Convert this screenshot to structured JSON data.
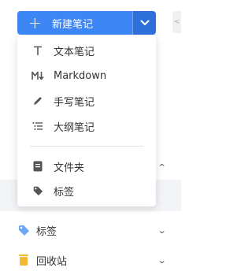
{
  "new_note": {
    "label": "新建笔记",
    "plus_icon": "plus-icon",
    "dropdown_icon": "chevron-down-icon",
    "accent": "#3d86f5"
  },
  "menu": {
    "items": [
      {
        "label": "文本笔记",
        "icon": "text-T-icon"
      },
      {
        "label": "Markdown",
        "icon": "markdown-icon"
      },
      {
        "label": "手写笔记",
        "icon": "pen-icon"
      },
      {
        "label": "大纲笔记",
        "icon": "outline-list-icon"
      }
    ],
    "secondary": [
      {
        "label": "文件夹",
        "icon": "folder-doc-icon"
      },
      {
        "label": "标签",
        "icon": "tag-icon"
      }
    ]
  },
  "sidebar": {
    "tags": {
      "label": "标签",
      "icon": "tag-icon",
      "color": "#6ea8f7"
    },
    "trash": {
      "label": "回收站",
      "icon": "trash-icon",
      "color": "#f5b731"
    }
  },
  "collapse_tab": "<"
}
